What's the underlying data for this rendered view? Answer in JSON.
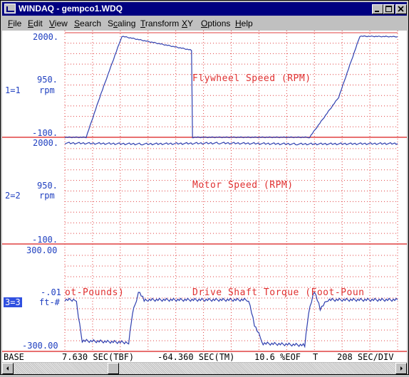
{
  "window": {
    "title": "WINDAQ - gempco1.WDQ",
    "minimize_icon": "minimize-icon",
    "maximize_icon": "maximize-icon",
    "close_icon": "close-icon"
  },
  "menu": {
    "items": [
      {
        "label": "File",
        "accel": "F"
      },
      {
        "label": "Edit",
        "accel": "E"
      },
      {
        "label": "View",
        "accel": "V"
      },
      {
        "label": "Search",
        "accel": "S"
      },
      {
        "label": "Scaling",
        "accel": "c"
      },
      {
        "label": "Transform",
        "accel": "T"
      },
      {
        "label": "XY",
        "accel": "X"
      },
      {
        "label": "Options",
        "accel": "O"
      },
      {
        "label": "Help",
        "accel": "H"
      }
    ]
  },
  "channels": [
    {
      "id": "1=1",
      "unit": "rpm",
      "top": "2000.",
      "mid": "950.",
      "bottom": "-100.",
      "title": "Flywheel Speed (RPM)"
    },
    {
      "id": "2=2",
      "unit": "rpm",
      "top": "2000.",
      "mid": "950.",
      "bottom": "-100.",
      "title": "Motor Speed (RPM)"
    },
    {
      "id": "3=3",
      "unit": "ft-#",
      "top": "300.00",
      "mid": "-.01",
      "bottom": "-300.00",
      "title": "Drive Shaft Torque (Foot-Pounds)",
      "title_fragment": "ot-Pounds)",
      "title_clipped": "Drive Shaft Torque (Foot-Poun"
    }
  ],
  "status": {
    "base": "BASE",
    "tbf": "7.630 SEC(TBF)",
    "tm": "-64.360 SEC(TM)",
    "eof": "10.6 %EOF",
    "tail": "T",
    "div": "208 SEC/DIV"
  },
  "colors": {
    "trace": "#3040b0",
    "grid": "#e04040",
    "label": "#2040c0",
    "titlebar": "#000080"
  },
  "chart_data": [
    {
      "type": "line",
      "title": "Flywheel Speed (RPM)",
      "ylabel": "rpm",
      "ylim": [
        -100,
        2000
      ],
      "ytick_labels": [
        "2000.",
        "950.",
        "-100."
      ],
      "series": [
        {
          "x": [
            0,
            22,
            36,
            59,
            131,
            132,
            133,
            253,
            283,
            305,
            344
          ],
          "values": [
            -100,
            -100,
            700,
            1930,
            1650,
            -100,
            -100,
            -100,
            700,
            1930,
            1920
          ]
        }
      ]
    },
    {
      "type": "line",
      "title": "Motor Speed (RPM)",
      "ylabel": "rpm",
      "ylim": [
        -100,
        2000
      ],
      "ytick_labels": [
        "2000.",
        "950.",
        "-100."
      ],
      "series": [
        {
          "x": [
            0,
            80,
            160,
            240,
            344
          ],
          "values": [
            1900,
            1880,
            1900,
            1880,
            1890
          ]
        }
      ]
    },
    {
      "type": "line",
      "title": "Drive Shaft Torque (Foot-Pounds)",
      "ylabel": "ft-#",
      "ylim": [
        -300,
        300
      ],
      "ytick_labels": [
        "300.00",
        "-.01",
        "-300.00"
      ],
      "series": [
        {
          "x": [
            0,
            12,
            14,
            18,
            66,
            70,
            74,
            76,
            82,
            86,
            190,
            196,
            205,
            248,
            252,
            258,
            264,
            272,
            344
          ],
          "values": [
            -10,
            -10,
            -100,
            -240,
            -250,
            -80,
            -10,
            40,
            -10,
            -10,
            -10,
            -150,
            -255,
            -265,
            -80,
            40,
            -60,
            -10,
            -10
          ]
        }
      ]
    }
  ]
}
